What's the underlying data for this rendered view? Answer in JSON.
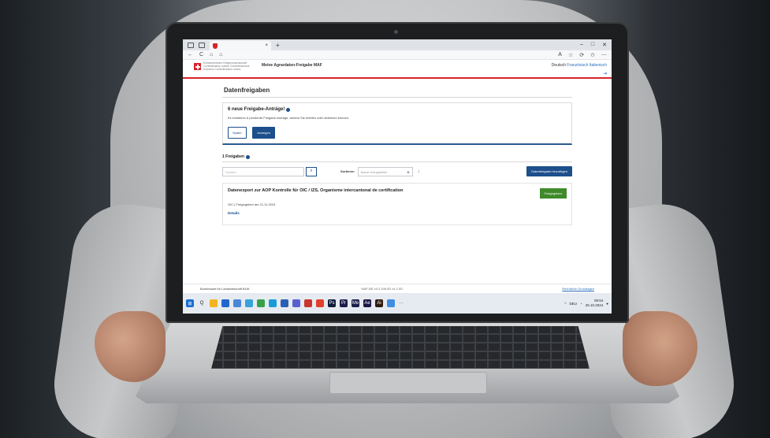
{
  "browser": {
    "tab_title": "",
    "close_tab": "×",
    "new_tab": "+",
    "win_min": "–",
    "win_max": "□",
    "win_close": "✕",
    "nav_back": "←",
    "nav_reload": "C",
    "nav_home": "⌂",
    "nav_lock": "⌂",
    "tools": [
      "A",
      "☆",
      "⟳",
      "✩",
      "⋯"
    ]
  },
  "site": {
    "confederation": "Schweizerische Eidgenossenschaft Confédération suisse Confederazione Svizzera Confederaziun svizra",
    "app_title": "Meine Agrardaten-Freigabe MAF",
    "lang_active": "Deutsch",
    "lang_fr": "Französisch",
    "lang_it": "Italienisch",
    "logout_icon": "⇥"
  },
  "page": {
    "title": "Datenfreigaben",
    "notice": {
      "title": "6 neue Freigabe-Anträge!",
      "text": "Es existieren 6 pendente Freigabe-Anträge, welche Sie erteilen oder ablehnen können.",
      "later_label": "Später",
      "show_label": "Anzeigen"
    },
    "section_title": "1 Freigaben",
    "search_placeholder": "Suchen",
    "search_icon": "⌕",
    "sort_label": "Sortieren",
    "sort_placeholder": "Name Antragsteller",
    "sort_clear": "⊗",
    "sort_dir": "↓",
    "add_label": "Datenfreigabe hinzufügen",
    "card": {
      "title": "Datenexport zur AOP Kontrolle für OIC / IZS, Organisme intercantonal de certification",
      "status": "Freigegeben",
      "meta": "OIC | Freigegeben am 21.11.2024",
      "details": "Details"
    }
  },
  "footer": {
    "org": "Bundesamt für Landwirtschaft BLW",
    "version": "MAF-BE v4.2.198.0D v4.2.0D",
    "legal": "Rechtliche Grundlagen"
  },
  "taskbar": {
    "start": "⊞",
    "search": "Q",
    "more": "···",
    "tray_chevron": "^",
    "lang": "DEU",
    "time": "09:54",
    "date": "25.10.2024",
    "app_icons": [
      {
        "name": "file-explorer-icon",
        "color": "#f2b420",
        "glyph": ""
      },
      {
        "name": "app-icon",
        "color": "#2266cc",
        "glyph": ""
      },
      {
        "name": "app-icon",
        "color": "#4c86d9",
        "glyph": ""
      },
      {
        "name": "app-icon",
        "color": "#36a3d9",
        "glyph": ""
      },
      {
        "name": "app-icon",
        "color": "#37a14a",
        "glyph": ""
      },
      {
        "name": "app-icon",
        "color": "#1b9bd6",
        "glyph": ""
      },
      {
        "name": "app-icon",
        "color": "#2b5fb3",
        "glyph": ""
      },
      {
        "name": "app-icon",
        "color": "#5a5fcf",
        "glyph": ""
      },
      {
        "name": "app-icon",
        "color": "#c9352c",
        "glyph": ""
      },
      {
        "name": "app-icon",
        "color": "#e0402c",
        "glyph": ""
      },
      {
        "name": "photoshop-icon",
        "color": "#0d1c3a",
        "glyph": "Ps"
      },
      {
        "name": "premiere-icon",
        "color": "#1e1b4a",
        "glyph": "Pr"
      },
      {
        "name": "media-encoder-icon",
        "color": "#1b1f4a",
        "glyph": "Me"
      },
      {
        "name": "after-effects-icon",
        "color": "#1b1646",
        "glyph": "Ae"
      },
      {
        "name": "illustrator-icon",
        "color": "#2f1a0d",
        "glyph": "Ai"
      },
      {
        "name": "notepad-icon",
        "color": "#3f8de0",
        "glyph": ""
      }
    ]
  }
}
